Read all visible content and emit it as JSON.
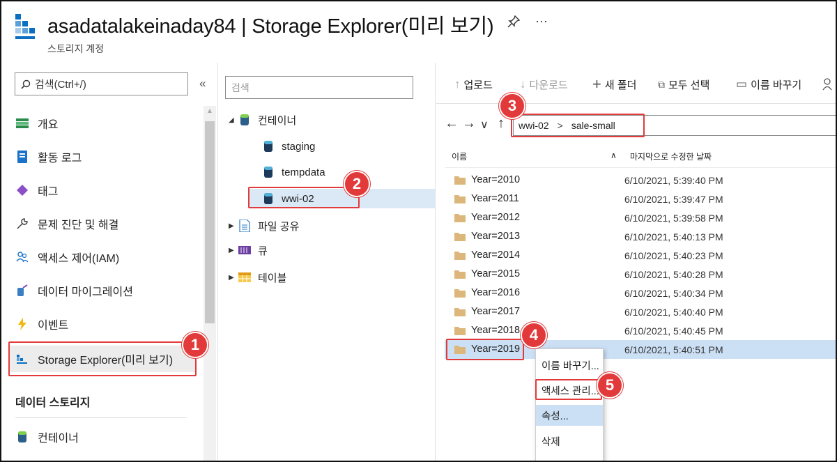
{
  "header": {
    "title": "asadatalakeinaday84 | Storage Explorer(미리 보기)",
    "subtitle": "스토리지 계정",
    "pin_icon": "pin-icon",
    "more_label": "···"
  },
  "nav": {
    "search_placeholder": "검색(Ctrl+/)",
    "collapse_label": "«",
    "items": [
      {
        "label": "개요",
        "icon": "overview-icon"
      },
      {
        "label": "활동 로그",
        "icon": "activity-log-icon"
      },
      {
        "label": "태그",
        "icon": "tag-icon"
      },
      {
        "label": "문제 진단 및 해결",
        "icon": "wrench-icon"
      },
      {
        "label": "액세스 제어(IAM)",
        "icon": "people-icon"
      },
      {
        "label": "데이터 마이그레이션",
        "icon": "migration-icon"
      },
      {
        "label": "이벤트",
        "icon": "lightning-icon"
      },
      {
        "label": "Storage Explorer(미리 보기)",
        "icon": "storage-explorer-icon"
      }
    ],
    "section_label": "데이터 스토리지",
    "section_items": [
      {
        "label": "컨테이너",
        "icon": "container-icon"
      }
    ]
  },
  "tree": {
    "search_placeholder": "검색",
    "root": {
      "label": "컨테이너",
      "expand": "◢"
    },
    "children": [
      {
        "label": "staging"
      },
      {
        "label": "tempdata"
      },
      {
        "label": "wwi-02"
      }
    ],
    "others": [
      {
        "label": "파일 공유",
        "expand": "▶"
      },
      {
        "label": "큐",
        "expand": "▶"
      },
      {
        "label": "테이블",
        "expand": "▶"
      }
    ]
  },
  "toolbar": {
    "upload": "업로드",
    "download": "다운로드",
    "new_folder": "새 폴더",
    "select_all": "모두 선택",
    "rename": "이름 바꾸기",
    "upload_icon": "↑",
    "download_icon": "↓",
    "new_folder_icon": "+",
    "select_all_icon": "⧉",
    "rename_icon": "▭",
    "more_icon": "person-icon"
  },
  "path": {
    "back": "←",
    "forward": "→",
    "dropdown": "∨",
    "up": "↑",
    "segments": [
      "wwi-02",
      "sale-small"
    ],
    "separator": ">"
  },
  "list": {
    "col_name": "이름",
    "col_sort": "∧",
    "col_modified": "마지막으로 수정한 날짜",
    "rows": [
      {
        "name": "Year=2010",
        "modified": "6/10/2021, 5:39:40 PM"
      },
      {
        "name": "Year=2011",
        "modified": "6/10/2021, 5:39:47 PM"
      },
      {
        "name": "Year=2012",
        "modified": "6/10/2021, 5:39:58 PM"
      },
      {
        "name": "Year=2013",
        "modified": "6/10/2021, 5:40:13 PM"
      },
      {
        "name": "Year=2014",
        "modified": "6/10/2021, 5:40:23 PM"
      },
      {
        "name": "Year=2015",
        "modified": "6/10/2021, 5:40:28 PM"
      },
      {
        "name": "Year=2016",
        "modified": "6/10/2021, 5:40:34 PM"
      },
      {
        "name": "Year=2017",
        "modified": "6/10/2021, 5:40:40 PM"
      },
      {
        "name": "Year=2018",
        "modified": "6/10/2021, 5:40:45 PM"
      },
      {
        "name": "Year=2019",
        "modified": "6/10/2021, 5:40:51 PM"
      }
    ]
  },
  "context_menu": {
    "items": [
      "이름 바꾸기...",
      "액세스 관리...",
      "속성...",
      "삭제"
    ]
  },
  "callouts": [
    "1",
    "2",
    "3",
    "4",
    "5"
  ],
  "colors": {
    "accent": "#0078d4",
    "callout": "#e23a3a",
    "selection": "#cce0f5",
    "folder": "#dcb67a"
  }
}
